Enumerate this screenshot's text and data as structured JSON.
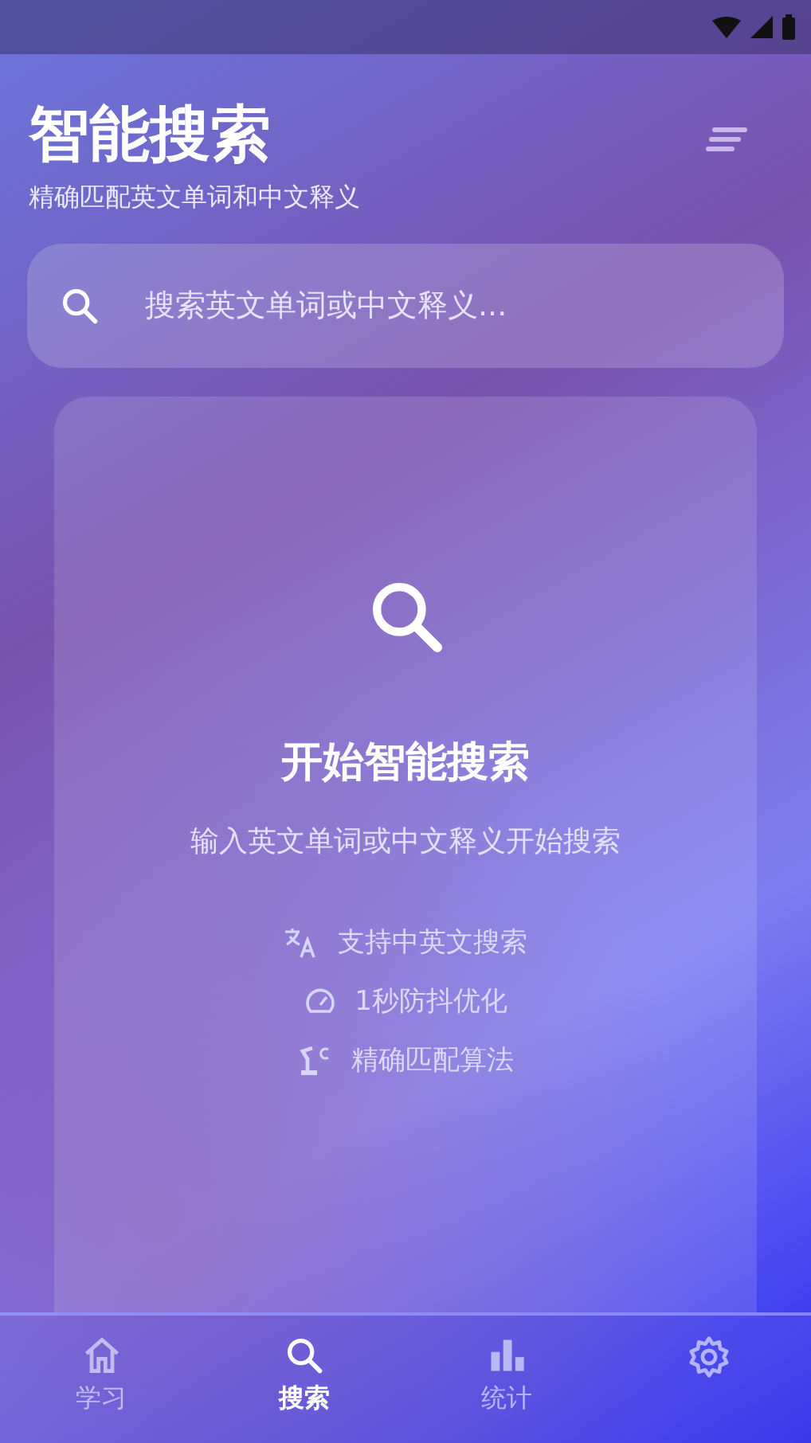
{
  "header": {
    "title": "智能搜索",
    "subtitle": "精确匹配英文单词和中文释义"
  },
  "search": {
    "placeholder": "搜索英文单词或中文释义..."
  },
  "empty_state": {
    "title": "开始智能搜索",
    "hint": "输入英文单词或中文释义开始搜索",
    "features": [
      {
        "kind": "translate",
        "label": "支持中英文搜索"
      },
      {
        "kind": "speed",
        "label": "1秒防抖优化"
      },
      {
        "kind": "robot",
        "label": "精确匹配算法"
      }
    ]
  },
  "nav": [
    {
      "kind": "home",
      "label": "学习",
      "selected": false
    },
    {
      "kind": "search",
      "label": "搜索",
      "selected": true
    },
    {
      "kind": "stats",
      "label": "统计",
      "selected": false
    },
    {
      "kind": "settings",
      "selected": false
    }
  ]
}
